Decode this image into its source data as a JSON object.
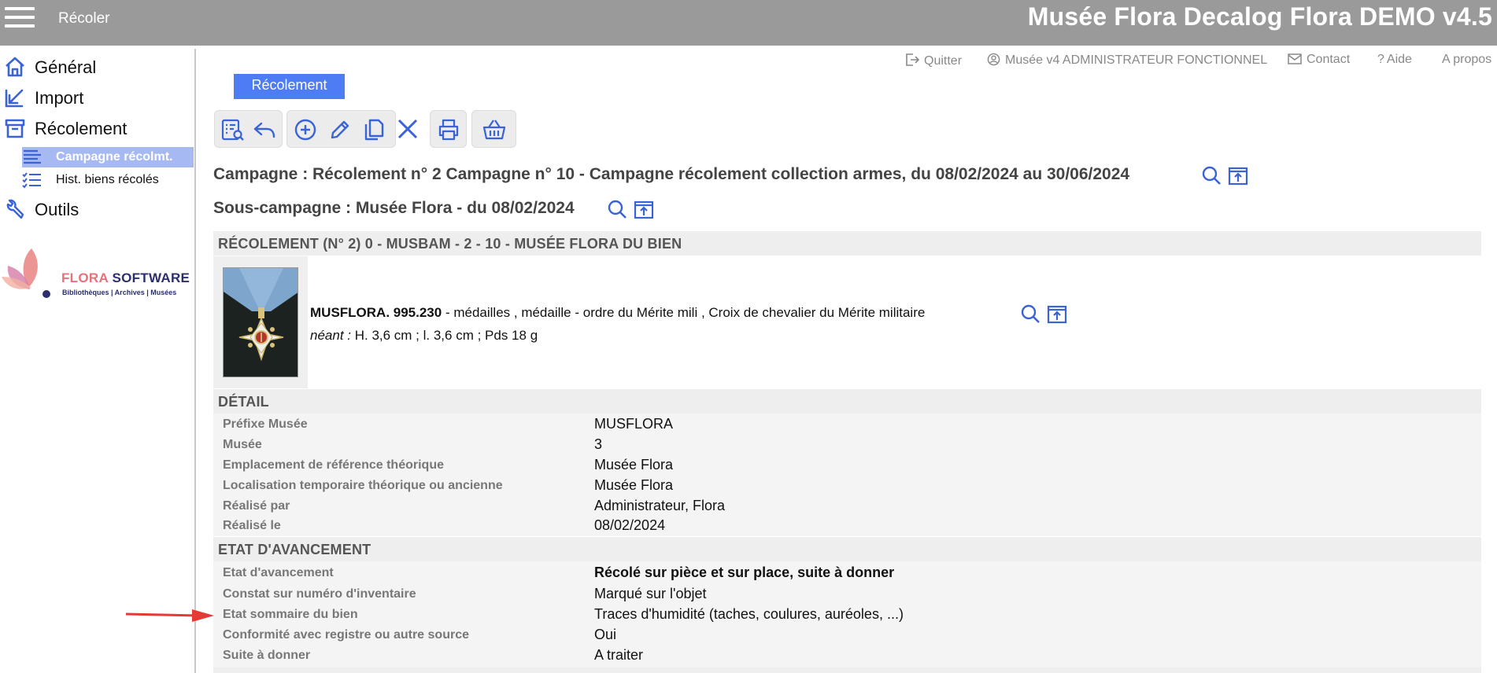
{
  "header": {
    "menu_icon": "hamburger-menu-icon",
    "page_title": "Récoler",
    "app_title": "Musée Flora Decalog Flora DEMO v4.5"
  },
  "sidebar": {
    "items": [
      {
        "label": "Général",
        "icon": "home-icon"
      },
      {
        "label": "Import",
        "icon": "import-icon"
      },
      {
        "label": "Récolement",
        "icon": "archive-box-icon"
      },
      {
        "label": "Outils",
        "icon": "wrench-icon"
      }
    ],
    "subitems": [
      {
        "label": "Campagne récolmt.",
        "icon": "list-icon",
        "active": true
      },
      {
        "label": "Hist. biens récolés",
        "icon": "checklist-icon",
        "active": false
      }
    ],
    "logo": {
      "brand_a": "FLORA",
      "brand_b": "SOFTWARE",
      "tagline": "Bibliothèques | Archives | Musées"
    }
  },
  "top_links": {
    "quit": "Quitter",
    "user": "Musée v4 ADMINISTRATEUR FONCTIONNEL",
    "contact": "Contact",
    "help": "Aide",
    "about": "A propos"
  },
  "tab": {
    "label": "Récolement"
  },
  "toolbar": {
    "buttons": [
      "search-list-icon",
      "undo-icon",
      "add-icon",
      "edit-icon",
      "copy-icon",
      "delete-icon",
      "print-icon",
      "basket-icon"
    ]
  },
  "campaign": {
    "title": "Campagne : Récolement n° 2 Campagne n° 10 - Campagne récolement collection armes, du 08/02/2024 au 30/06/2024"
  },
  "subcampaign": {
    "title": "Sous-campagne : Musée Flora - du 08/02/2024"
  },
  "record": {
    "header": "RÉCOLEMENT (N° 2) 0 - MUSBAM - 2 - 10 - MUSÉE FLORA DU BIEN",
    "inventory": "MUSFLORA. 995.230",
    "description": " - médailles , médaille - ordre du Mérite mili , Croix de chevalier du Mérite militaire",
    "dim_label": "néant :",
    "dimensions": " H. 3,6 cm ; l. 3,6 cm ; Pds 18  g"
  },
  "detail": {
    "header": "DÉTAIL",
    "rows": [
      {
        "key": "Préfixe Musée",
        "value": "MUSFLORA"
      },
      {
        "key": "Musée",
        "value": "3"
      },
      {
        "key": "Emplacement de référence théorique",
        "value": "Musée Flora"
      },
      {
        "key": "Localisation temporaire théorique ou ancienne",
        "value": "Musée Flora"
      },
      {
        "key": "Réalisé par",
        "value": "Administrateur, Flora"
      },
      {
        "key": "Réalisé le",
        "value": "08/02/2024"
      }
    ]
  },
  "progress": {
    "header": "ETAT D'AVANCEMENT",
    "rows": [
      {
        "key": "Etat d'avancement",
        "value": "Récolé sur pièce et sur place, suite à donner"
      },
      {
        "key": "Constat sur numéro d'inventaire",
        "value": "Marqué sur l'objet"
      },
      {
        "key": "Etat sommaire du bien",
        "value": "Traces d'humidité (taches, coulures, auréoles, ...)"
      },
      {
        "key": "Conformité avec registre ou autre source",
        "value": "Oui"
      },
      {
        "key": "Suite à donner",
        "value": "A traiter"
      }
    ]
  },
  "colors": {
    "accent": "#4d7cf4",
    "icon": "#3a63d8",
    "topbar": "#9a9a9a",
    "annotation_arrow": "#e53935"
  }
}
